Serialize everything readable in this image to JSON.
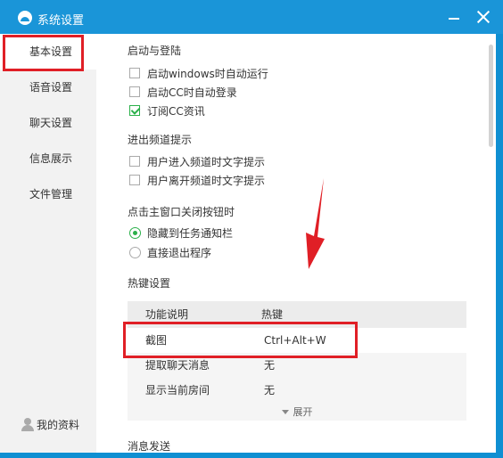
{
  "window": {
    "title": "系统设置"
  },
  "sidebar": {
    "items": [
      {
        "label": "基本设置",
        "active": true
      },
      {
        "label": "语音设置"
      },
      {
        "label": "聊天设置"
      },
      {
        "label": "信息展示"
      },
      {
        "label": "文件管理"
      }
    ],
    "profile_label": "我的资料"
  },
  "sections": {
    "startup": {
      "title": "启动与登陆",
      "options": [
        {
          "label": "启动windows时自动运行",
          "checked": false
        },
        {
          "label": "启动CC时自动登录",
          "checked": false
        },
        {
          "label": "订阅CC资讯",
          "checked": true
        }
      ]
    },
    "channel_tips": {
      "title": "进出频道提示",
      "options": [
        {
          "label": "用户进入频道时文字提示",
          "checked": false
        },
        {
          "label": "用户离开频道时文字提示",
          "checked": false
        }
      ]
    },
    "close_action": {
      "title": "点击主窗口关闭按钮时",
      "options": [
        {
          "label": "隐藏到任务通知栏",
          "selected": true
        },
        {
          "label": "直接退出程序",
          "selected": false
        }
      ]
    },
    "hotkeys": {
      "title": "热键设置",
      "headers": [
        "功能说明",
        "热键"
      ],
      "rows": [
        {
          "function": "截图",
          "key": "Ctrl+Alt+W"
        },
        {
          "function": "提取聊天消息",
          "key": "无"
        },
        {
          "function": "显示当前房间",
          "key": "无"
        }
      ],
      "expand_label": "展开"
    },
    "message_send": {
      "title": "消息发送"
    }
  },
  "colors": {
    "titlebar": "#1a95d8",
    "highlight_box": "#e01f26",
    "check": "#2bb04a",
    "arrow": "#e01f26"
  }
}
